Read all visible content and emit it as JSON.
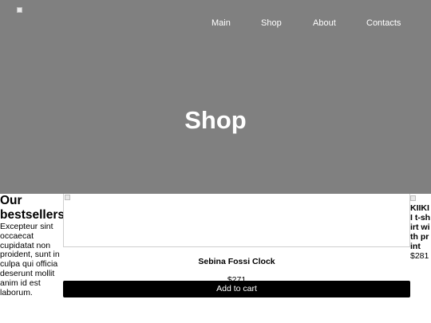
{
  "nav": {
    "items": [
      {
        "label": "Main"
      },
      {
        "label": "Shop"
      },
      {
        "label": "About"
      },
      {
        "label": "Contacts"
      }
    ]
  },
  "hero": {
    "title": "Shop"
  },
  "bestsellers": {
    "title": "Our bestsellers",
    "description": "Excepteur sint occaecat cupidatat non proident, sunt in culpa qui officia deserunt mollit anim id est laborum."
  },
  "products": [
    {
      "name": "Sebina Fossi Clock",
      "price": "$271",
      "button_label": "Add to cart"
    },
    {
      "name": "KIIKII t-shirt with print",
      "price": "$281"
    }
  ]
}
